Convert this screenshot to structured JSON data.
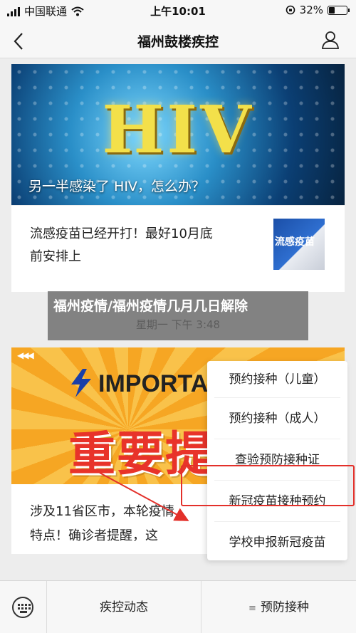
{
  "status": {
    "carrier": "中国联通",
    "time": "上午10:01",
    "battery": "32%",
    "battery_level": 0.32
  },
  "nav": {
    "back_icon": "chevron-left-icon",
    "title": "福州鼓楼疾控",
    "user_icon": "user-icon"
  },
  "articles": [
    {
      "image_text": "HIV",
      "caption": "另一半感染了 HIV，怎么办？"
    },
    {
      "title_line1": "流感疫苗已经开打！最好10月底",
      "title_line2": "前安排上",
      "thumb_text": "流感疫苗"
    }
  ],
  "timestamp": "星期一 下午 3:48",
  "promo": {
    "banner_en": "IMPORTA",
    "banner_cn": "重要提",
    "line1": "涉及11省区市，本轮疫情",
    "line2": "特点！确诊者提醒，这"
  },
  "menu": {
    "items": [
      "预约接种（儿童）",
      "预约接种（成人）",
      "查验预防接种证",
      "新冠疫苗接种预约",
      "学校申报新冠疫苗"
    ]
  },
  "overlay": {
    "text": "福州疫情/福州疫情几月几日解除"
  },
  "tabbar": {
    "keyboard_icon": "keyboard-icon",
    "tab1": "疾控动态",
    "tab2": "预防接种",
    "tab2_icon": "menu-icon"
  },
  "colors": {
    "highlight": "#e3302a",
    "hiv_text": "#f3e04a"
  }
}
